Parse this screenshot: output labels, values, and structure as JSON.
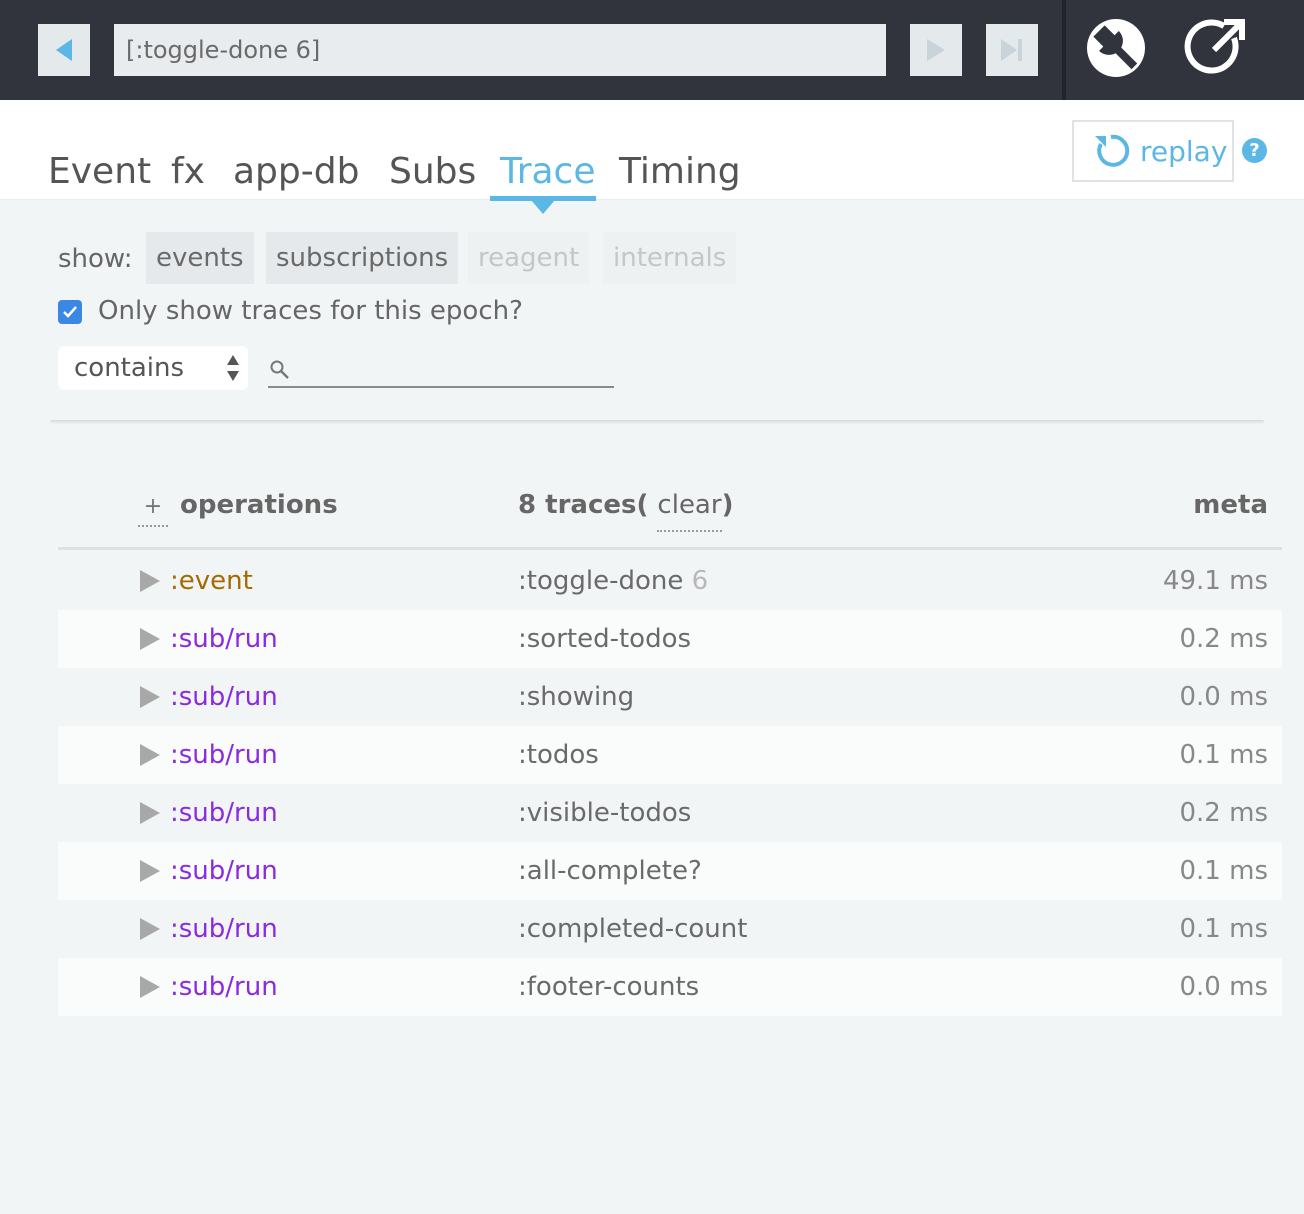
{
  "topbar": {
    "event_value": "[:toggle-done 6]"
  },
  "tabs": [
    {
      "label": "Event"
    },
    {
      "label": "fx"
    },
    {
      "label": "app-db"
    },
    {
      "label": "Subs"
    },
    {
      "label": "Trace"
    },
    {
      "label": "Timing"
    }
  ],
  "active_tab": "Trace",
  "replay_label": "replay",
  "help_label": "?",
  "filters": {
    "show_label": "show:",
    "categories": [
      {
        "label": "events",
        "enabled": true
      },
      {
        "label": "subscriptions",
        "enabled": true
      },
      {
        "label": "reagent",
        "enabled": false
      },
      {
        "label": "internals",
        "enabled": false
      }
    ],
    "epoch_checkbox_label": "Only show traces for this epoch?",
    "epoch_checked": true,
    "match_mode": "contains",
    "search_value": ""
  },
  "table": {
    "expand_label": "+",
    "ops_header": "operations",
    "count_prefix": "8 traces",
    "open_paren": "(",
    "clear_label": "clear",
    "close_paren": ")",
    "meta_header": "meta",
    "rows": [
      {
        "op": ":event",
        "name": ":toggle-done",
        "arg": "6",
        "duration": "49.1 ms"
      },
      {
        "op": ":sub/run",
        "name": ":sorted-todos",
        "arg": "",
        "duration": "0.2 ms"
      },
      {
        "op": ":sub/run",
        "name": ":showing",
        "arg": "",
        "duration": "0.0 ms"
      },
      {
        "op": ":sub/run",
        "name": ":todos",
        "arg": "",
        "duration": "0.1 ms"
      },
      {
        "op": ":sub/run",
        "name": ":visible-todos",
        "arg": "",
        "duration": "0.2 ms"
      },
      {
        "op": ":sub/run",
        "name": ":all-complete?",
        "arg": "",
        "duration": "0.1 ms"
      },
      {
        "op": ":sub/run",
        "name": ":completed-count",
        "arg": "",
        "duration": "0.1 ms"
      },
      {
        "op": ":sub/run",
        "name": ":footer-counts",
        "arg": "",
        "duration": "0.0 ms"
      }
    ]
  },
  "colors": {
    "accent": "#5bb7e5",
    "topbar": "#32343d",
    "event_op": "#a76a00",
    "sub_op": "#8a2be2",
    "checkbox": "#3b87e4"
  },
  "icons": {
    "back": "triangle-left-icon",
    "play": "play-icon",
    "skip": "skip-to-end-icon",
    "settings": "wrench-icon",
    "popout": "popout-icon",
    "replay": "replay-icon",
    "search": "search-icon"
  }
}
